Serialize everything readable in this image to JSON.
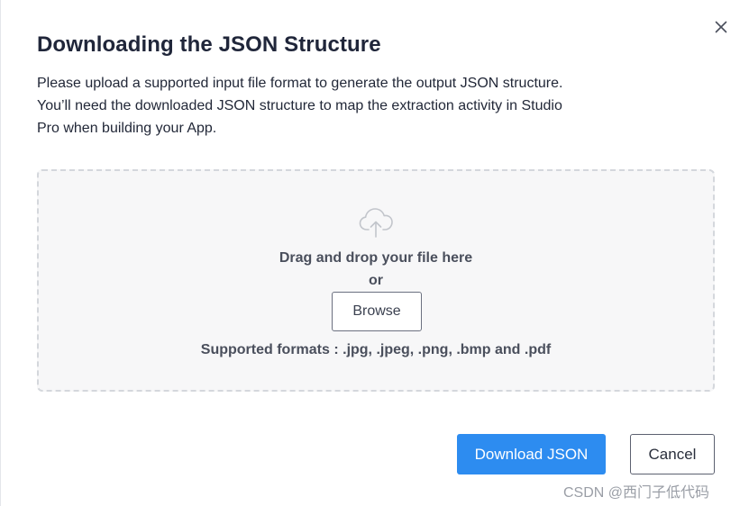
{
  "dialog": {
    "title": "Downloading the JSON Structure",
    "description_lines": [
      "Please upload a supported input file format to generate the output JSON structure.",
      "You’ll need the downloaded JSON structure to map the extraction activity in Studio",
      "Pro when building your App."
    ],
    "close_icon": "close-icon"
  },
  "dropzone": {
    "icon": "cloud-upload-icon",
    "drag_text": "Drag and drop your file here",
    "or_text": "or",
    "browse_label": "Browse",
    "formats_text": "Supported formats : .jpg, .jpeg, .png, .bmp and .pdf"
  },
  "footer": {
    "download_label": "Download JSON",
    "cancel_label": "Cancel"
  },
  "watermark": "CSDN @西门子低代码",
  "colors": {
    "primary": "#2d8cf0",
    "dropzone_bg": "#f7f7f8",
    "dropzone_border": "#d4d7dc"
  }
}
